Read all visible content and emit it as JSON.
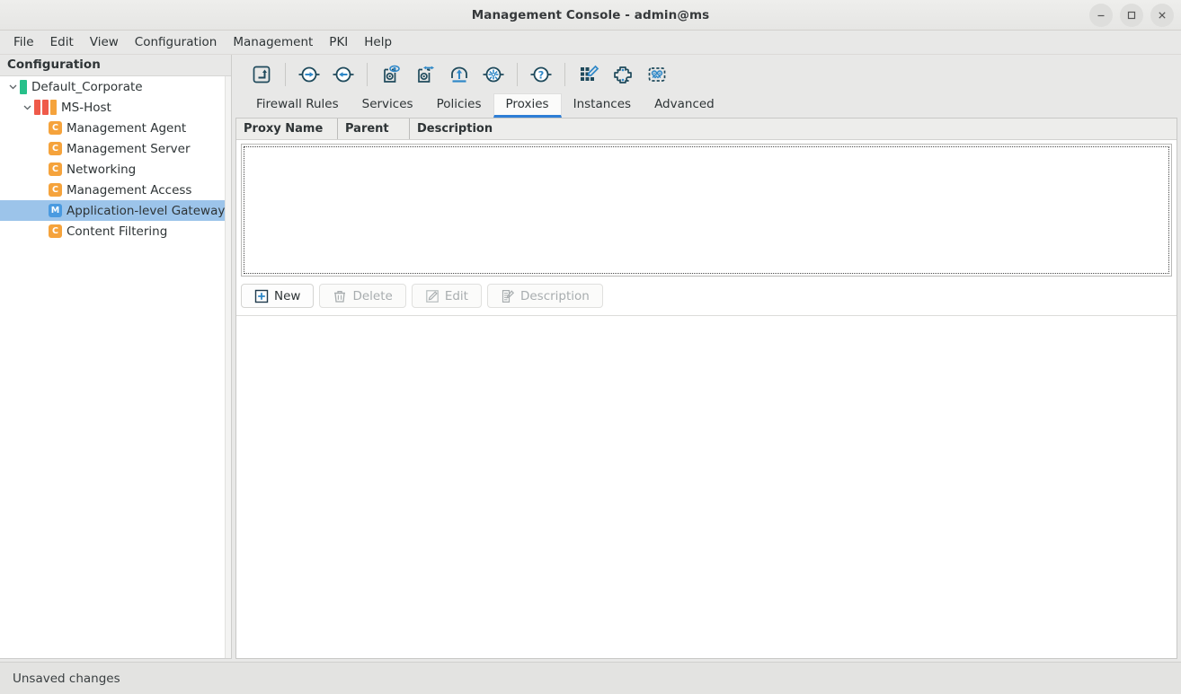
{
  "window": {
    "title": "Management Console - admin@ms",
    "controls": [
      {
        "name": "minimize",
        "glyph": "minimize-icon"
      },
      {
        "name": "maximize",
        "glyph": "maximize-icon"
      },
      {
        "name": "close",
        "glyph": "close-icon"
      }
    ]
  },
  "menubar": {
    "items": [
      {
        "label": "File"
      },
      {
        "label": "Edit"
      },
      {
        "label": "View"
      },
      {
        "label": "Configuration"
      },
      {
        "label": "Management"
      },
      {
        "label": "PKI"
      },
      {
        "label": "Help"
      }
    ]
  },
  "sidebar": {
    "header": "Configuration",
    "items": [
      {
        "label": "Default_Corporate",
        "icon": "green-bar-icon",
        "level": 1,
        "expanded": true,
        "selected": false
      },
      {
        "label": "MS-Host",
        "icon": "host-bars-icon",
        "level": 2,
        "expanded": true,
        "selected": false
      },
      {
        "label": "Management Agent",
        "icon": "c-badge-icon",
        "badge": "C",
        "level": 3,
        "selected": false
      },
      {
        "label": "Management Server",
        "icon": "c-badge-icon",
        "badge": "C",
        "level": 3,
        "selected": false
      },
      {
        "label": "Networking",
        "icon": "c-badge-icon",
        "badge": "C",
        "level": 3,
        "selected": false
      },
      {
        "label": "Management Access",
        "icon": "c-badge-icon",
        "badge": "C",
        "level": 3,
        "selected": false
      },
      {
        "label": "Application-level Gateway",
        "icon": "m-badge-icon",
        "badge": "M",
        "level": 3,
        "selected": true
      },
      {
        "label": "Content Filtering",
        "icon": "c-badge-icon",
        "badge": "C",
        "level": 3,
        "selected": false
      }
    ]
  },
  "toolbar": {
    "buttons": [
      {
        "name": "go-up-icon",
        "tooltip": "Up"
      },
      {
        "name": "forward-arrow-icon",
        "tooltip": "Forward"
      },
      {
        "name": "back-arrow-icon",
        "tooltip": "Back"
      },
      {
        "name": "preview-config-icon",
        "tooltip": "Preview configuration"
      },
      {
        "name": "compare-config-icon",
        "tooltip": "Compare configuration"
      },
      {
        "name": "upload-cloud-icon",
        "tooltip": "Upload"
      },
      {
        "name": "settings-gear-icon",
        "tooltip": "Settings"
      },
      {
        "name": "help-question-icon",
        "tooltip": "Help"
      },
      {
        "name": "edit-matrix-icon",
        "tooltip": "Edit matrix"
      },
      {
        "name": "plugin-icon",
        "tooltip": "Plugin"
      },
      {
        "name": "robot-icon",
        "tooltip": "Automation"
      }
    ]
  },
  "tabs": {
    "items": [
      {
        "label": "Firewall Rules",
        "active": false
      },
      {
        "label": "Services",
        "active": false
      },
      {
        "label": "Policies",
        "active": false
      },
      {
        "label": "Proxies",
        "active": true
      },
      {
        "label": "Instances",
        "active": false
      },
      {
        "label": "Advanced",
        "active": false
      }
    ],
    "accent_color": "#2f7fd6"
  },
  "table": {
    "columns": [
      "Proxy Name",
      "Parent",
      "Description"
    ],
    "rows": []
  },
  "actions": {
    "buttons": [
      {
        "label": "New",
        "icon": "plus-box-icon",
        "enabled": true
      },
      {
        "label": "Delete",
        "icon": "trash-icon",
        "enabled": false
      },
      {
        "label": "Edit",
        "icon": "pencil-square-icon",
        "enabled": false
      },
      {
        "label": "Description",
        "icon": "document-edit-icon",
        "enabled": false
      }
    ]
  },
  "statusbar": {
    "message": "Unsaved changes"
  },
  "colors": {
    "selection": "#9cc4ea",
    "accent": "#2f7fd6",
    "icon_dark": "#1f4a5c",
    "icon_blue": "#2f88c8",
    "badge_c": "#f5a33c",
    "badge_m": "#4a9ae0",
    "host_red": "#ef5a4a",
    "host_orange": "#f5a33c",
    "green": "#27c08a"
  }
}
